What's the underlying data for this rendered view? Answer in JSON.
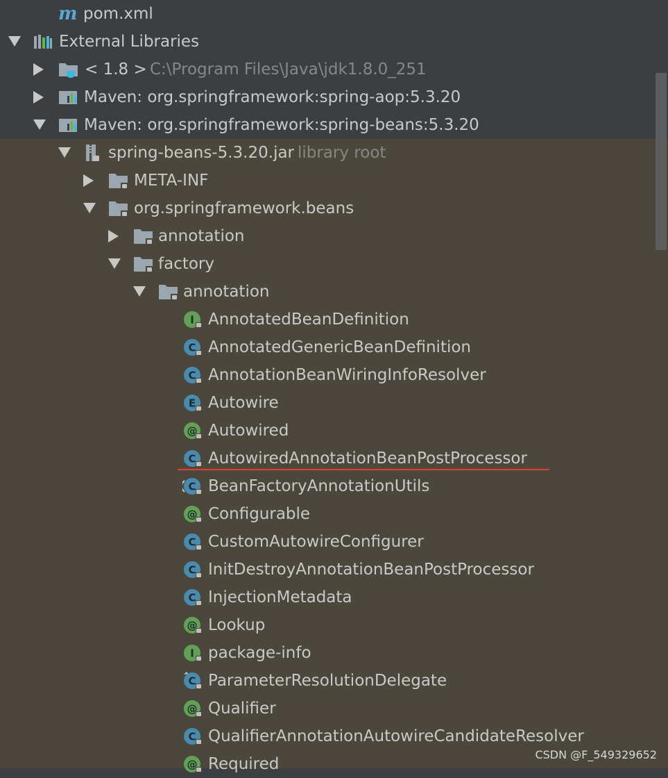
{
  "tree": {
    "pom": {
      "label": "pom.xml"
    },
    "external_libraries": {
      "label": "External Libraries"
    },
    "jdk": {
      "label": "< 1.8 >",
      "path": "C:\\Program Files\\Java\\jdk1.8.0_251"
    },
    "maven_aop": {
      "label": "Maven: org.springframework:spring-aop:5.3.20"
    },
    "maven_beans": {
      "label": "Maven: org.springframework:spring-beans:5.3.20"
    },
    "jar": {
      "label": "spring-beans-5.3.20.jar",
      "suffix": "library root"
    },
    "meta_inf": {
      "label": "META-INF"
    },
    "beans_pkg": {
      "label": "org.springframework.beans"
    },
    "annotation_pkg": {
      "label": "annotation"
    },
    "factory_pkg": {
      "label": "factory"
    },
    "factory_annotation_pkg": {
      "label": "annotation"
    },
    "classes": [
      {
        "label": "AnnotatedBeanDefinition",
        "kind": "interface",
        "badge": "I"
      },
      {
        "label": "AnnotatedGenericBeanDefinition",
        "kind": "class",
        "badge": "C"
      },
      {
        "label": "AnnotationBeanWiringInfoResolver",
        "kind": "class",
        "badge": "C"
      },
      {
        "label": "Autowire",
        "kind": "enum",
        "badge": "E"
      },
      {
        "label": "Autowired",
        "kind": "annotation",
        "badge": "@"
      },
      {
        "label": "AutowiredAnnotationBeanPostProcessor",
        "kind": "class",
        "badge": "C"
      },
      {
        "label": "BeanFactoryAnnotationUtils",
        "kind": "abstract-class",
        "badge": "C"
      },
      {
        "label": "Configurable",
        "kind": "annotation",
        "badge": "@"
      },
      {
        "label": "CustomAutowireConfigurer",
        "kind": "class",
        "badge": "C"
      },
      {
        "label": "InitDestroyAnnotationBeanPostProcessor",
        "kind": "class",
        "badge": "C"
      },
      {
        "label": "InjectionMetadata",
        "kind": "class",
        "badge": "C"
      },
      {
        "label": "Lookup",
        "kind": "annotation",
        "badge": "@"
      },
      {
        "label": "package-info",
        "kind": "interface",
        "badge": "I"
      },
      {
        "label": "ParameterResolutionDelegate",
        "kind": "final-class",
        "badge": "C"
      },
      {
        "label": "Qualifier",
        "kind": "annotation",
        "badge": "@"
      },
      {
        "label": "QualifierAnnotationAutowireCandidateResolver",
        "kind": "class",
        "badge": "C"
      },
      {
        "label": "Required",
        "kind": "annotation",
        "badge": "@"
      }
    ]
  },
  "highlight": {
    "underline_color": "#e53935"
  },
  "colors": {
    "class_badge": "#4a8bad",
    "annotation_badge": "#62a155",
    "interface_badge": "#62a155",
    "enum_badge": "#4a8bad"
  },
  "watermark": "CSDN @F_549329652"
}
